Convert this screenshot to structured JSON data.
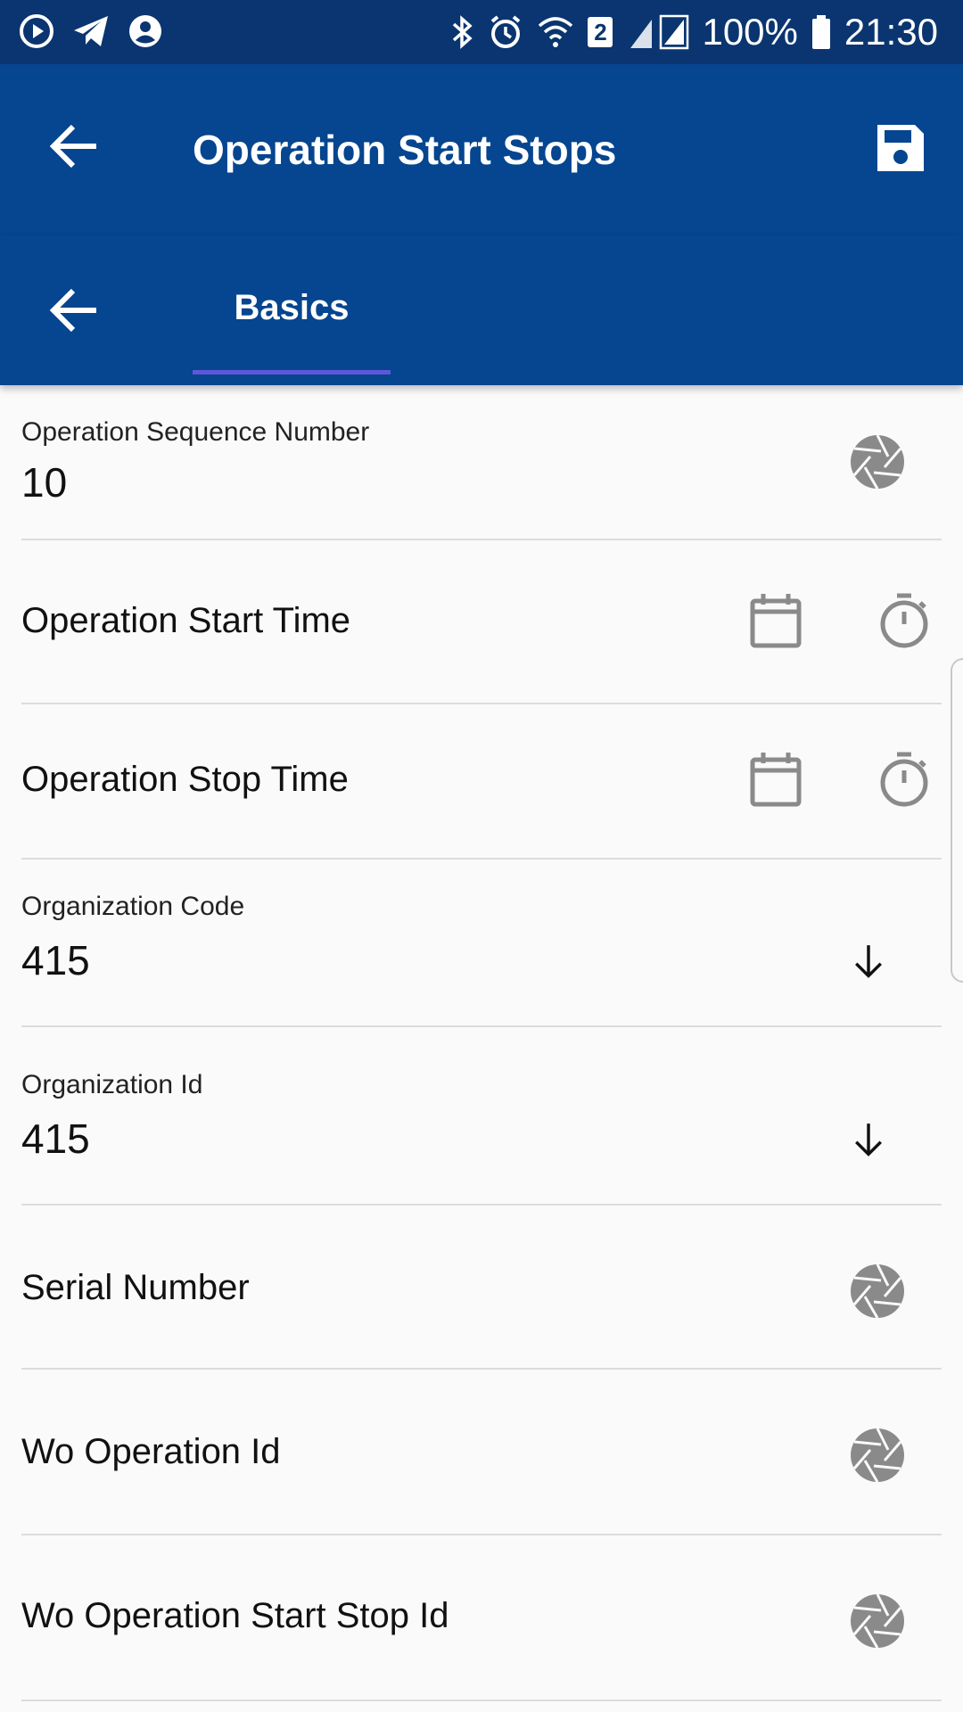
{
  "status_bar": {
    "battery": "100%",
    "time": "21:30",
    "sim_badge": "2",
    "icons": [
      "media-play-icon",
      "telegram-icon",
      "account-icon",
      "bluetooth-icon",
      "alarm-icon",
      "wifi-icon",
      "signal-icon",
      "battery-icon"
    ]
  },
  "app_bar": {
    "title": "Operation Start Stops",
    "back_icon": "arrow-back-icon",
    "save_icon": "save-icon"
  },
  "tab_bar": {
    "tabs": [
      {
        "label": "Basics",
        "selected": true
      }
    ]
  },
  "fields": [
    {
      "label": "Operation Sequence Number",
      "value": "10",
      "icon": "camera-shutter-icon"
    },
    {
      "label": "Operation Start Time",
      "icons": [
        "calendar-icon",
        "stopwatch-icon"
      ]
    },
    {
      "label": "Operation Stop Time",
      "icons": [
        "calendar-icon",
        "stopwatch-icon"
      ]
    },
    {
      "label": "Organization Code",
      "value": "415",
      "icon": "arrow-down-icon"
    },
    {
      "label": "Organization Id",
      "value": "415",
      "icon": "arrow-down-icon"
    },
    {
      "label": "Serial Number",
      "icon": "camera-shutter-icon"
    },
    {
      "label": "Wo Operation Id",
      "icon": "camera-shutter-icon"
    },
    {
      "label": "Wo Operation Start Stop Id",
      "icon": "camera-shutter-icon"
    }
  ],
  "colors": {
    "status_bar": "#0a3570",
    "app_bar": "#06458f",
    "tab_indicator": "#5e57d8",
    "background": "#fafafa",
    "icon_grey": "#8a8a8a"
  }
}
